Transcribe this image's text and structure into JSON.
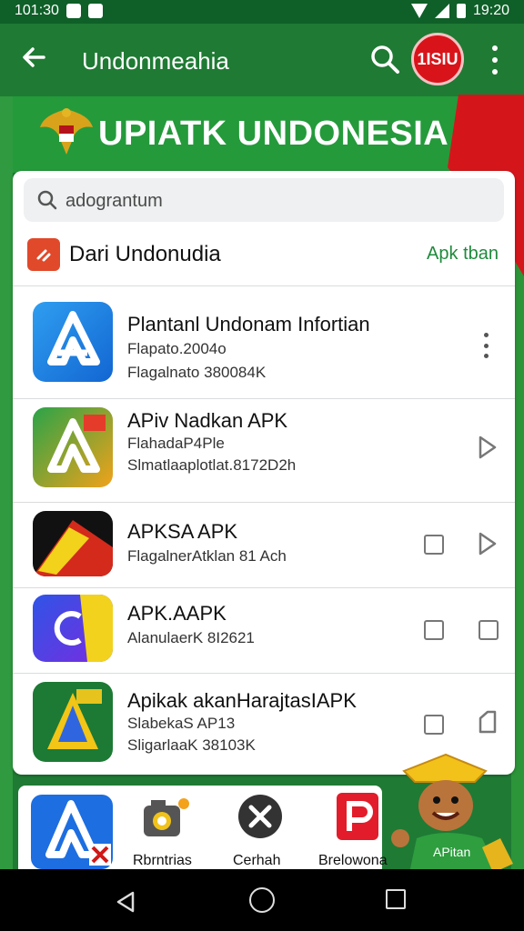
{
  "status": {
    "time_left": "101:30",
    "time_right": "19:20"
  },
  "appbar": {
    "title": "Undonmeahia",
    "badge_text": "1ISIU"
  },
  "banner": {
    "title": "UPIATK UNDONESIA"
  },
  "search": {
    "value": "adograntum"
  },
  "section": {
    "title": "Dari Undonudia",
    "link": "Apk tban"
  },
  "apps": [
    {
      "name": "Plantanl Undonam Infortian",
      "meta1": "Flapato.2004o",
      "meta2": "Flagalnato 380084K"
    },
    {
      "name": "APiv Nadkan APK",
      "meta1": "FlahadaP4Ple",
      "meta2": "Slmatlaaplotlat.8172D2h"
    },
    {
      "name": "APKSA APK",
      "meta1": "FlagalnerAtklan 81 Ach"
    },
    {
      "name": "APK.AAPK",
      "meta1": "AlanulaerK 8I2621"
    },
    {
      "name": "Apikak akanHarajtasIAPK",
      "meta1": "SlabekaS AP13",
      "meta2": "SligarlaaK 38103K"
    }
  ],
  "dock": [
    {
      "label": ""
    },
    {
      "label": "Rbrntrias"
    },
    {
      "label": "Cerhah"
    },
    {
      "label": "Brelowona"
    }
  ],
  "mascot": {
    "shirt_text": "APitan"
  },
  "colors": {
    "primary": "#1f7a34",
    "accent": "#d8141a",
    "link": "#1f8a3c"
  }
}
